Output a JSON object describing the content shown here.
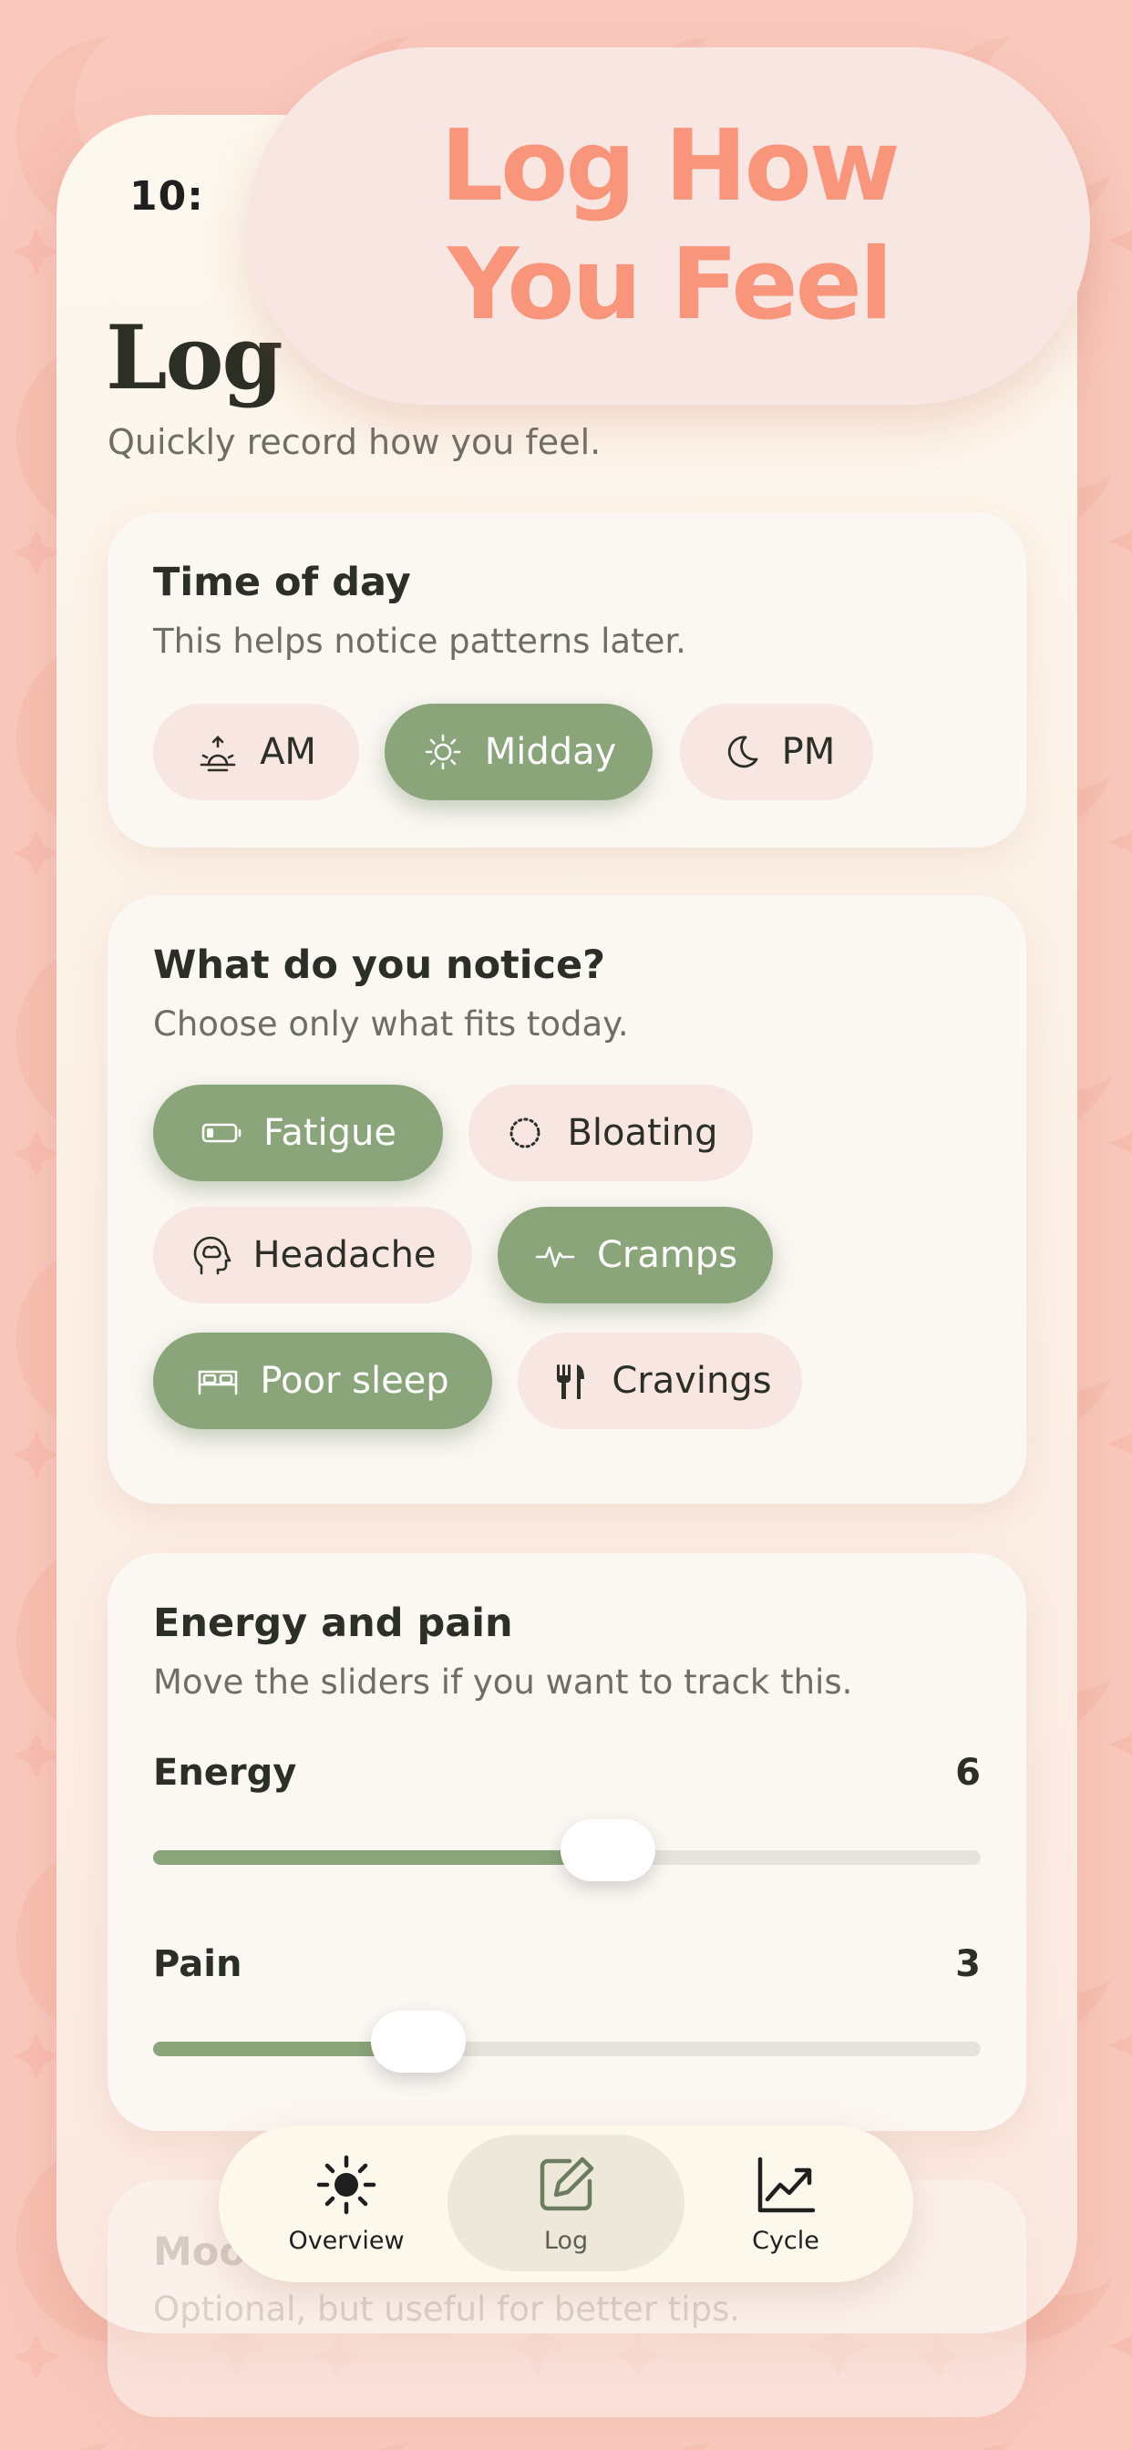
{
  "status": {
    "time": "10:"
  },
  "promo": {
    "line1": "Log How",
    "line2": "You Feel"
  },
  "header": {
    "title": "Log",
    "subtitle": "Quickly record how you feel."
  },
  "time_of_day": {
    "title": "Time of day",
    "subtitle": "This helps notice patterns later.",
    "options": [
      {
        "label": "AM",
        "icon": "sunrise-icon",
        "selected": false
      },
      {
        "label": "Midday",
        "icon": "sun-icon",
        "selected": true
      },
      {
        "label": "PM",
        "icon": "moon-icon",
        "selected": false
      }
    ]
  },
  "symptoms": {
    "title": "What do you notice?",
    "subtitle": "Choose only what fits today.",
    "options": [
      {
        "label": "Fatigue",
        "icon": "battery-low-icon",
        "selected": true
      },
      {
        "label": "Bloating",
        "icon": "dotted-circle-icon",
        "selected": false
      },
      {
        "label": "Headache",
        "icon": "head-brain-icon",
        "selected": false
      },
      {
        "label": "Cramps",
        "icon": "waveform-icon",
        "selected": true
      },
      {
        "label": "Poor sleep",
        "icon": "bed-icon",
        "selected": true
      },
      {
        "label": "Cravings",
        "icon": "fork-knife-icon",
        "selected": false
      }
    ]
  },
  "energy_pain": {
    "title": "Energy and pain",
    "subtitle": "Move the sliders if you want to track this.",
    "energy": {
      "label": "Energy",
      "value": "6",
      "fraction": 0.55
    },
    "pain": {
      "label": "Pain",
      "value": "3",
      "fraction": 0.32
    }
  },
  "next_card": {
    "title_partial": "Moo",
    "subtitle": "Optional, but useful for better tips."
  },
  "tabbar": {
    "tabs": [
      {
        "label": "Overview",
        "icon": "sun-icon",
        "active": false
      },
      {
        "label": "Log",
        "icon": "edit-square-icon",
        "active": true
      },
      {
        "label": "Cycle",
        "icon": "chart-line-up-icon",
        "active": false
      }
    ]
  },
  "colors": {
    "accent_green": "#8ba57a",
    "chip_pink": "#f8e6e2",
    "promo_coral": "#f8957b",
    "background_pink": "#f9c9bd"
  }
}
